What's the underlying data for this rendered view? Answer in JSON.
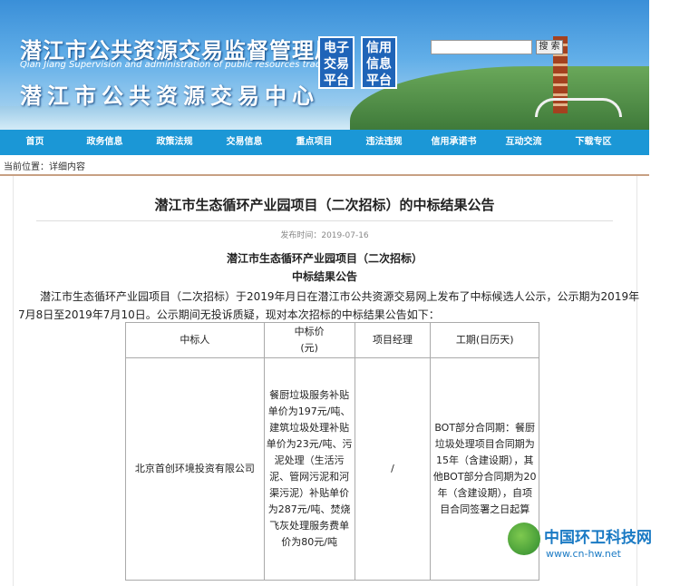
{
  "header": {
    "title_cn": "潜江市公共资源交易监督管理局",
    "title_en": "Qian Jiang Supervision and administration of public resources trading",
    "title_center": "潜江市公共资源交易中心",
    "badge_1": [
      "电子",
      "交易",
      "平台"
    ],
    "badge_2": [
      "信用",
      "信息",
      "平台"
    ],
    "search_placeholder": "",
    "search_button": "搜 索"
  },
  "nav": {
    "items": [
      "首页",
      "政务信息",
      "政策法规",
      "交易信息",
      "重点项目",
      "违法违规",
      "信用承诺书",
      "互动交流",
      "下载专区"
    ]
  },
  "breadcrumb": "当前位置：详细内容",
  "article": {
    "title": "潜江市生态循环产业园项目（二次招标）的中标结果公告",
    "pubdate": "发布时间：2019-07-16",
    "sub_title_1": "潜江市生态循环产业园项目（二次招标）",
    "sub_title_2": "中标结果公告",
    "paragraph": "潜江市生态循环产业园项目（二次招标）于2019年月日在潜江市公共资源交易网上发布了中标候选人公示，公示期为2019年7月8日至2019年7月10日。公示期间无投诉质疑，现对本次招标的中标结果公告如下："
  },
  "table": {
    "headers": [
      "中标人",
      "中标价\n(元)",
      "项目经理",
      "工期(日历天)"
    ],
    "rows": [
      {
        "winner": "北京首创环境投资有限公司",
        "price": "餐厨垃圾服务补贴单价为197元/吨、建筑垃圾处理补贴单价为23元/吨、污泥处理（生活污泥、管网污泥和河渠污泥）补贴单价为287元/吨、焚烧飞灰处理服务费单价为80元/吨",
        "manager": "/",
        "period": "BOT部分合同期：餐厨垃圾处理项目合同期为15年（含建设期），其他BOT部分合同期为20年（含建设期），自项目合同签署之日起算"
      }
    ]
  },
  "watermark": {
    "text": "中国环卫科技网",
    "url": "www.cn-hw.net"
  }
}
